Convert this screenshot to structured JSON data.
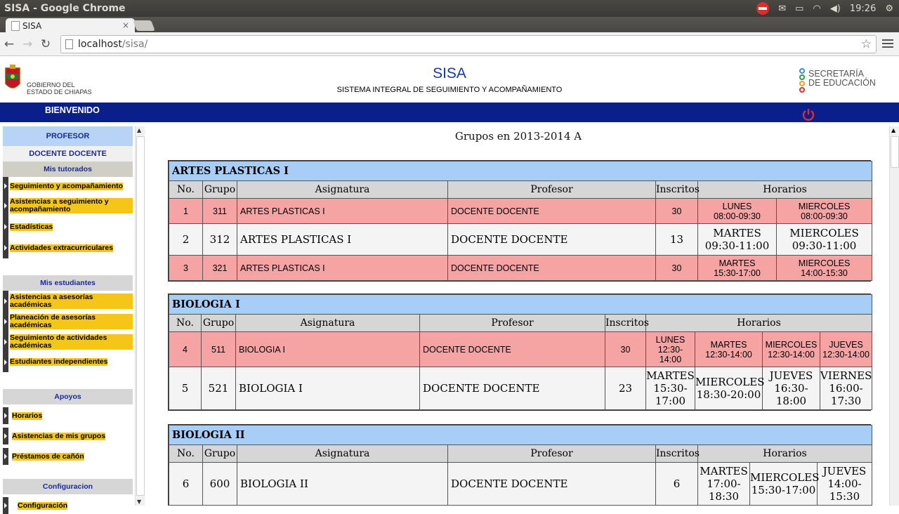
{
  "window": {
    "title": "SISA - Google Chrome",
    "clock": "19:26"
  },
  "tab": {
    "label": "SISA",
    "close": "×"
  },
  "address": {
    "host": "localhost",
    "path": "/sisa/"
  },
  "header": {
    "gob_line1": "GOBIERNO DEL",
    "gob_line2": "ESTADO DE CHIAPAS",
    "title": "SISA",
    "subtitle": "SISTEMA INTEGRAL DE SEGUIMIENTO Y ACOMPAÑAMIENTO",
    "sep_line1": "SECRETARÍA",
    "sep_line2": "DE EDUCACIÓN",
    "welcome": "BIENVENIDO"
  },
  "sidebar": {
    "role": "PROFESOR",
    "user": "DOCENTE DOCENTE",
    "sections": [
      {
        "title": "Mis tutorados",
        "items": [
          "Seguimiento y acompañamiento",
          "Asistencias a seguimiento y acompañamiento",
          "Estadísticas",
          "Actividades extracurriculares"
        ]
      },
      {
        "title": "Mis estudiantes",
        "items": [
          "Asistencias a asesorías académicas",
          "Planeación de asesorías académicas",
          "Seguimiento de actividades académicas",
          "Estudiantes independientes"
        ]
      },
      {
        "title": "Apoyos",
        "items": [
          "Horarios",
          "Asistencias de mis grupos",
          "Préstamos de cañón"
        ]
      },
      {
        "title": "Configuracion",
        "items": [
          "Configuración"
        ]
      }
    ]
  },
  "main": {
    "title": "Grupos en 2013-2014 A",
    "columns": {
      "no": "No.",
      "grupo": "Grupo",
      "asignatura": "Asignatura",
      "profesor": "Profesor",
      "inscritos": "Inscritos",
      "horarios": "Horarios"
    },
    "courses": [
      {
        "name": "ARTES PLASTICAS I",
        "rows": [
          {
            "no": "1",
            "grupo": "311",
            "asignatura": "ARTES PLASTICAS I",
            "profesor": "DOCENTE DOCENTE",
            "inscritos": "30",
            "highlight": true,
            "horarios": [
              [
                "LUNES",
                "08:00-09:30"
              ],
              [
                "MIERCOLES",
                "08:00-09:30"
              ]
            ]
          },
          {
            "no": "2",
            "grupo": "312",
            "asignatura": "ARTES PLASTICAS I",
            "profesor": "DOCENTE DOCENTE",
            "inscritos": "13",
            "highlight": false,
            "horarios": [
              [
                "MARTES",
                "09:30-11:00"
              ],
              [
                "MIERCOLES",
                "09:30-11:00"
              ]
            ]
          },
          {
            "no": "3",
            "grupo": "321",
            "asignatura": "ARTES PLASTICAS I",
            "profesor": "DOCENTE DOCENTE",
            "inscritos": "30",
            "highlight": true,
            "horarios": [
              [
                "MARTES",
                "15:30-17:00"
              ],
              [
                "MIERCOLES",
                "14:00-15:30"
              ]
            ]
          }
        ]
      },
      {
        "name": "BIOLOGIA I",
        "rows": [
          {
            "no": "4",
            "grupo": "511",
            "asignatura": "BIOLOGIA I",
            "profesor": "DOCENTE DOCENTE",
            "inscritos": "30",
            "highlight": true,
            "horarios": [
              [
                "LUNES",
                "12:30-",
                "14:00"
              ],
              [
                "MARTES",
                "12:30-14:00"
              ],
              [
                "MIERCOLES",
                "12:30-14:00"
              ],
              [
                "JUEVES",
                "12:30-14:00"
              ]
            ]
          },
          {
            "no": "5",
            "grupo": "521",
            "asignatura": "BIOLOGIA I",
            "profesor": "DOCENTE DOCENTE",
            "inscritos": "23",
            "highlight": false,
            "horarios": [
              [
                "MARTES",
                "15:30-",
                "17:00"
              ],
              [
                "MIERCOLES",
                "18:30-20:00"
              ],
              [
                "JUEVES",
                "16:30-18:00"
              ],
              [
                "VIERNES",
                "16:00-",
                "17:30"
              ]
            ]
          }
        ]
      },
      {
        "name": "BIOLOGIA II",
        "rows": [
          {
            "no": "6",
            "grupo": "600",
            "asignatura": "BIOLOGIA II",
            "profesor": "DOCENTE DOCENTE",
            "inscritos": "6",
            "highlight": false,
            "horarios": [
              [
                "MARTES",
                "17:00-",
                "18:30"
              ],
              [
                "MIERCOLES",
                "15:30-17:00"
              ],
              [
                "JUEVES",
                "14:00-",
                "15:30"
              ]
            ]
          }
        ]
      }
    ]
  },
  "colors": {
    "navy_bar": "#0a1e8c",
    "course_header": "#a8cdf7",
    "highlight_row": "#f5a3a3",
    "menu_highlight": "#f5c517"
  }
}
